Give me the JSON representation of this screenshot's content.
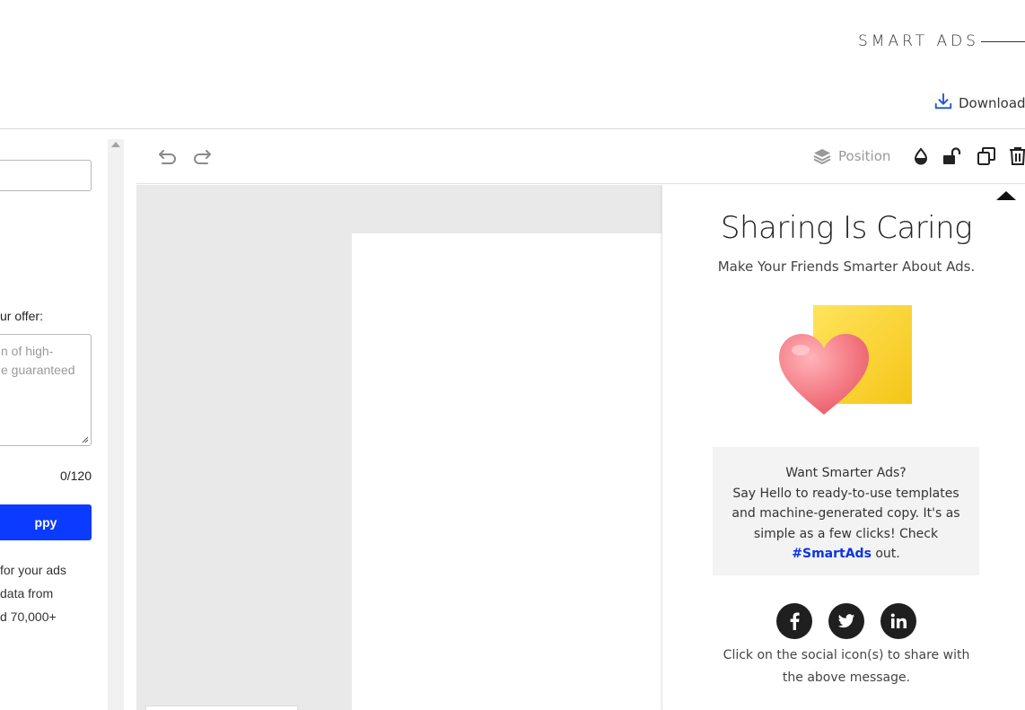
{
  "header": {
    "brand": "SMART ADS",
    "download_label": "Download"
  },
  "left_panel": {
    "offer_label": "ur offer:",
    "offer_placeholder": "n of high-\ne guaranteed",
    "char_count": "0/120",
    "copy_button_label": "ppy",
    "description": "for your ads\ndata from\nd 70,000+"
  },
  "toolbar": {
    "position_label": "Position"
  },
  "share_panel": {
    "title": "Sharing Is Caring",
    "subtitle": "Make Your Friends Smarter About Ads.",
    "promo_line1": "Want Smarter Ads?",
    "promo_line2": "Say Hello to ready-to-use templates",
    "promo_line3": "and machine-generated copy. It's as",
    "promo_line4": "simple as a few clicks! Check",
    "promo_hashtag": "#SmartAds",
    "promo_suffix": " out.",
    "social": [
      "facebook-icon",
      "twitter-icon",
      "linkedin-icon"
    ],
    "note": "Click on the social icon(s) to share with the above message."
  },
  "colors": {
    "accent_blue": "#0b3bff",
    "hashtag_blue": "#0b33e6",
    "heart_pink": "#f47a84",
    "square_yellow": "#f7d230",
    "canvas_gray": "#e9e9e9"
  }
}
